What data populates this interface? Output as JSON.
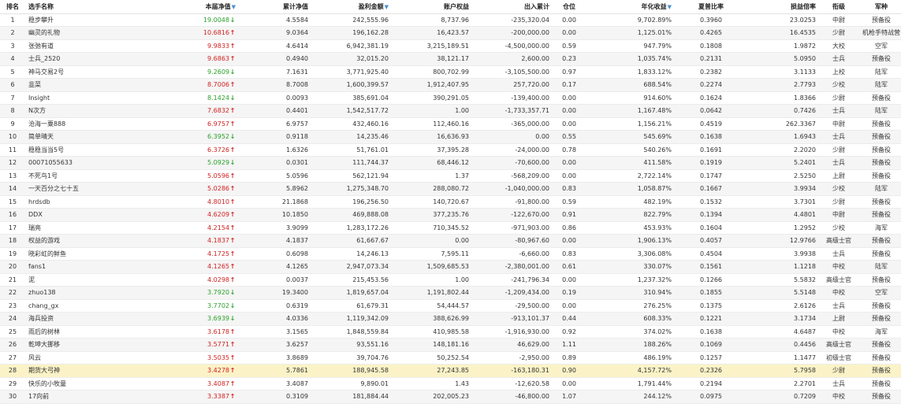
{
  "headers": {
    "rank": "排名",
    "name": "选手名称",
    "nav": "本届净值",
    "cum_nav": "累计净值",
    "profit": "盈利金额",
    "equity": "账户权益",
    "net_flow": "出入累计",
    "position": "仓位",
    "annual": "年化收益",
    "sharpe": "夏普比率",
    "pl_ratio": "损益倍率",
    "rank_title": "衔级",
    "branch": "军种"
  },
  "colors": {
    "up": "#d11f1f",
    "down": "#2aa12a",
    "sort": "#4a8fd6",
    "highlight": "#fbf3c7"
  },
  "rows": [
    {
      "rank": "1",
      "name": "稳步攀升",
      "nav": "19.0048",
      "dir": "down",
      "cum_nav": "4.5584",
      "profit": "242,555.96",
      "equity": "8,737.96",
      "net_flow": "-235,320.04",
      "position": "0.00",
      "annual": "9,702.89%",
      "sharpe": "0.3960",
      "pl_ratio": "23.0253",
      "rank_title": "中尉",
      "branch": "预备役"
    },
    {
      "rank": "2",
      "name": "幽灵的礼物",
      "nav": "10.6816",
      "dir": "up",
      "cum_nav": "9.0364",
      "profit": "196,162.28",
      "equity": "16,423.57",
      "net_flow": "-200,000.00",
      "position": "0.00",
      "annual": "1,125.01%",
      "sharpe": "0.4265",
      "pl_ratio": "16.4535",
      "rank_title": "少尉",
      "branch": "机枪手特战营"
    },
    {
      "rank": "3",
      "name": "张弛有道",
      "nav": "9.9833",
      "dir": "up",
      "cum_nav": "4.6414",
      "profit": "6,942,381.19",
      "equity": "3,215,189.51",
      "net_flow": "-4,500,000.00",
      "position": "0.59",
      "annual": "947.79%",
      "sharpe": "0.1808",
      "pl_ratio": "1.9872",
      "rank_title": "大校",
      "branch": "空军"
    },
    {
      "rank": "4",
      "name": "士兵_2520",
      "nav": "9.6863",
      "dir": "up",
      "cum_nav": "0.4940",
      "profit": "32,015.20",
      "equity": "38,121.17",
      "net_flow": "2,600.00",
      "position": "0.23",
      "annual": "1,035.74%",
      "sharpe": "0.2131",
      "pl_ratio": "5.0950",
      "rank_title": "士兵",
      "branch": "预备役"
    },
    {
      "rank": "5",
      "name": "神马交易2号",
      "nav": "9.2609",
      "dir": "down",
      "cum_nav": "7.1631",
      "profit": "3,771,925.40",
      "equity": "800,702.99",
      "net_flow": "-3,105,500.00",
      "position": "0.97",
      "annual": "1,833.12%",
      "sharpe": "0.2382",
      "pl_ratio": "3.1133",
      "rank_title": "上校",
      "branch": "陆军"
    },
    {
      "rank": "6",
      "name": "韭菜",
      "nav": "8.7006",
      "dir": "up",
      "cum_nav": "8.7008",
      "profit": "1,600,399.57",
      "equity": "1,912,407.95",
      "net_flow": "257,720.00",
      "position": "0.17",
      "annual": "688.54%",
      "sharpe": "0.2274",
      "pl_ratio": "2.7793",
      "rank_title": "少校",
      "branch": "陆军"
    },
    {
      "rank": "7",
      "name": "Insight",
      "nav": "8.1424",
      "dir": "down",
      "cum_nav": "0.0093",
      "profit": "385,691.04",
      "equity": "390,291.05",
      "net_flow": "-139,400.00",
      "position": "0.00",
      "annual": "914.60%",
      "sharpe": "0.1624",
      "pl_ratio": "1.8366",
      "rank_title": "少尉",
      "branch": "预备役"
    },
    {
      "rank": "8",
      "name": "N次方",
      "nav": "7.6832",
      "dir": "up",
      "cum_nav": "0.4401",
      "profit": "1,542,517.72",
      "equity": "1.00",
      "net_flow": "-1,733,357.71",
      "position": "0.00",
      "annual": "1,167.48%",
      "sharpe": "0.0642",
      "pl_ratio": "0.7426",
      "rank_title": "士兵",
      "branch": "陆军"
    },
    {
      "rank": "9",
      "name": "沧海一粟888",
      "nav": "6.9757",
      "dir": "up",
      "cum_nav": "6.9757",
      "profit": "432,460.16",
      "equity": "112,460.16",
      "net_flow": "-365,000.00",
      "position": "0.00",
      "annual": "1,156.21%",
      "sharpe": "0.4519",
      "pl_ratio": "262.3367",
      "rank_title": "中尉",
      "branch": "预备役"
    },
    {
      "rank": "10",
      "name": "简单晴天",
      "nav": "6.3952",
      "dir": "down",
      "cum_nav": "0.9118",
      "profit": "14,235.46",
      "equity": "16,636.93",
      "net_flow": "0.00",
      "position": "0.55",
      "annual": "545.69%",
      "sharpe": "0.1638",
      "pl_ratio": "1.6943",
      "rank_title": "士兵",
      "branch": "预备役"
    },
    {
      "rank": "11",
      "name": "稳稳当当5号",
      "nav": "6.3726",
      "dir": "up",
      "cum_nav": "1.6326",
      "profit": "51,761.01",
      "equity": "37,395.28",
      "net_flow": "-24,000.00",
      "position": "0.78",
      "annual": "540.26%",
      "sharpe": "0.1691",
      "pl_ratio": "2.2020",
      "rank_title": "少尉",
      "branch": "预备役"
    },
    {
      "rank": "12",
      "name": "00071055633",
      "nav": "5.0929",
      "dir": "down",
      "cum_nav": "0.0301",
      "profit": "111,744.37",
      "equity": "68,446.12",
      "net_flow": "-70,600.00",
      "position": "0.00",
      "annual": "411.58%",
      "sharpe": "0.1919",
      "pl_ratio": "5.2401",
      "rank_title": "士兵",
      "branch": "预备役"
    },
    {
      "rank": "13",
      "name": "不死鸟1号",
      "nav": "5.0596",
      "dir": "up",
      "cum_nav": "5.0596",
      "profit": "562,121.94",
      "equity": "1.37",
      "net_flow": "-568,209.00",
      "position": "0.00",
      "annual": "2,722.14%",
      "sharpe": "0.1747",
      "pl_ratio": "2.5250",
      "rank_title": "上尉",
      "branch": "预备役"
    },
    {
      "rank": "14",
      "name": "一天百分之七十五",
      "nav": "5.0286",
      "dir": "up",
      "cum_nav": "5.8962",
      "profit": "1,275,348.70",
      "equity": "288,080.72",
      "net_flow": "-1,040,000.00",
      "position": "0.83",
      "annual": "1,058.87%",
      "sharpe": "0.1667",
      "pl_ratio": "3.9934",
      "rank_title": "少校",
      "branch": "陆军"
    },
    {
      "rank": "15",
      "name": "hrdsdb",
      "nav": "4.8010",
      "dir": "up",
      "cum_nav": "21.1868",
      "profit": "196,256.50",
      "equity": "140,720.67",
      "net_flow": "-91,800.00",
      "position": "0.59",
      "annual": "482.19%",
      "sharpe": "0.1532",
      "pl_ratio": "3.7301",
      "rank_title": "少尉",
      "branch": "预备役"
    },
    {
      "rank": "16",
      "name": "DDX",
      "nav": "4.6209",
      "dir": "up",
      "cum_nav": "10.1850",
      "profit": "469,888.08",
      "equity": "377,235.76",
      "net_flow": "-122,670.00",
      "position": "0.91",
      "annual": "822.79%",
      "sharpe": "0.1394",
      "pl_ratio": "4.4801",
      "rank_title": "中尉",
      "branch": "预备役"
    },
    {
      "rank": "17",
      "name": "瑞亮",
      "nav": "4.2154",
      "dir": "up",
      "cum_nav": "3.9099",
      "profit": "1,283,172.26",
      "equity": "710,345.52",
      "net_flow": "-971,903.00",
      "position": "0.86",
      "annual": "453.93%",
      "sharpe": "0.1604",
      "pl_ratio": "1.2952",
      "rank_title": "少校",
      "branch": "海军"
    },
    {
      "rank": "18",
      "name": "权益的游戏",
      "nav": "4.1837",
      "dir": "up",
      "cum_nav": "4.1837",
      "profit": "61,667.67",
      "equity": "0.00",
      "net_flow": "-80,967.60",
      "position": "0.00",
      "annual": "1,906.13%",
      "sharpe": "0.4057",
      "pl_ratio": "12.9766",
      "rank_title": "高级士官",
      "branch": "预备役"
    },
    {
      "rank": "19",
      "name": "晓彩虹的鲜鱼",
      "nav": "4.1725",
      "dir": "up",
      "cum_nav": "0.6098",
      "profit": "14,246.13",
      "equity": "7,595.11",
      "net_flow": "-6,660.00",
      "position": "0.83",
      "annual": "3,306.08%",
      "sharpe": "0.4504",
      "pl_ratio": "3.9938",
      "rank_title": "士兵",
      "branch": "预备役"
    },
    {
      "rank": "20",
      "name": "fans1",
      "nav": "4.1265",
      "dir": "up",
      "cum_nav": "4.1265",
      "profit": "2,947,073.34",
      "equity": "1,509,685.53",
      "net_flow": "-2,380,001.00",
      "position": "0.61",
      "annual": "330.07%",
      "sharpe": "0.1561",
      "pl_ratio": "1.1218",
      "rank_title": "中校",
      "branch": "陆军"
    },
    {
      "rank": "21",
      "name": "泥",
      "nav": "4.0298",
      "dir": "up",
      "cum_nav": "0.0037",
      "profit": "215,453.56",
      "equity": "1.00",
      "net_flow": "-241,796.34",
      "position": "0.00",
      "annual": "1,237.32%",
      "sharpe": "0.1266",
      "pl_ratio": "5.5832",
      "rank_title": "高级士官",
      "branch": "预备役"
    },
    {
      "rank": "22",
      "name": "zhuo138",
      "nav": "3.7920",
      "dir": "down",
      "cum_nav": "19.3400",
      "profit": "1,819,657.04",
      "equity": "1,191,802.44",
      "net_flow": "-1,209,434.00",
      "position": "0.19",
      "annual": "310.94%",
      "sharpe": "0.1855",
      "pl_ratio": "5.5148",
      "rank_title": "中校",
      "branch": "空军"
    },
    {
      "rank": "23",
      "name": "chang_gx",
      "nav": "3.7702",
      "dir": "down",
      "cum_nav": "0.6319",
      "profit": "61,679.31",
      "equity": "54,444.57",
      "net_flow": "-29,500.00",
      "position": "0.00",
      "annual": "276.25%",
      "sharpe": "0.1375",
      "pl_ratio": "2.6126",
      "rank_title": "士兵",
      "branch": "预备役"
    },
    {
      "rank": "24",
      "name": "海兵投资",
      "nav": "3.6939",
      "dir": "down",
      "cum_nav": "4.0336",
      "profit": "1,119,342.09",
      "equity": "388,626.99",
      "net_flow": "-913,101.37",
      "position": "0.44",
      "annual": "608.33%",
      "sharpe": "0.1221",
      "pl_ratio": "3.1734",
      "rank_title": "上尉",
      "branch": "预备役"
    },
    {
      "rank": "25",
      "name": "雨后的树林",
      "nav": "3.6178",
      "dir": "up",
      "cum_nav": "3.1565",
      "profit": "1,848,559.84",
      "equity": "410,985.58",
      "net_flow": "-1,916,930.00",
      "position": "0.92",
      "annual": "374.02%",
      "sharpe": "0.1638",
      "pl_ratio": "4.6487",
      "rank_title": "中校",
      "branch": "海军"
    },
    {
      "rank": "26",
      "name": "乾坤大挪移",
      "nav": "3.5771",
      "dir": "up",
      "cum_nav": "3.6257",
      "profit": "93,551.16",
      "equity": "148,181.16",
      "net_flow": "46,629.00",
      "position": "1.11",
      "annual": "188.26%",
      "sharpe": "0.1069",
      "pl_ratio": "0.4456",
      "rank_title": "高级士官",
      "branch": "预备役"
    },
    {
      "rank": "27",
      "name": "风云",
      "nav": "3.5035",
      "dir": "up",
      "cum_nav": "3.8689",
      "profit": "39,704.76",
      "equity": "50,252.54",
      "net_flow": "-2,950.00",
      "position": "0.89",
      "annual": "486.19%",
      "sharpe": "0.1257",
      "pl_ratio": "1.1477",
      "rank_title": "初级士官",
      "branch": "预备役"
    },
    {
      "rank": "28",
      "name": "期货大弓神",
      "nav": "3.4278",
      "dir": "up",
      "cum_nav": "5.7861",
      "profit": "188,945.58",
      "equity": "27,243.85",
      "net_flow": "-163,180.31",
      "position": "0.90",
      "annual": "4,157.72%",
      "sharpe": "0.2326",
      "pl_ratio": "5.7958",
      "rank_title": "少尉",
      "branch": "预备役",
      "highlight": true
    },
    {
      "rank": "29",
      "name": "快乐的小牧童",
      "nav": "3.4087",
      "dir": "up",
      "cum_nav": "3.4087",
      "profit": "9,890.01",
      "equity": "1.43",
      "net_flow": "-12,620.58",
      "position": "0.00",
      "annual": "1,791.44%",
      "sharpe": "0.2194",
      "pl_ratio": "2.2701",
      "rank_title": "士兵",
      "branch": "预备役"
    },
    {
      "rank": "30",
      "name": "17向前",
      "nav": "3.3387",
      "dir": "up",
      "cum_nav": "0.3109",
      "profit": "181,884.44",
      "equity": "202,005.23",
      "net_flow": "-46,800.00",
      "position": "1.07",
      "annual": "244.12%",
      "sharpe": "0.0975",
      "pl_ratio": "0.7209",
      "rank_title": "中校",
      "branch": "预备役"
    }
  ]
}
